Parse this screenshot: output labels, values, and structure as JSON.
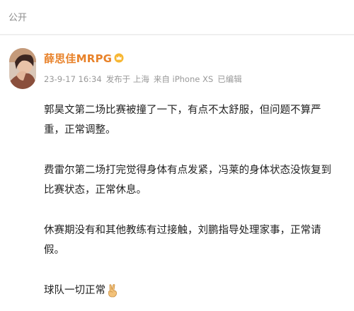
{
  "header": {
    "visibility_label": "公开"
  },
  "post": {
    "author": {
      "name": "薛思佳MRPG",
      "badge": "crown-badge-icon",
      "avatar": "avatar"
    },
    "meta": {
      "timestamp": "23-9-17 16:34",
      "location": "发布于 上海",
      "source": "来自 iPhone XS",
      "edited": "已编辑"
    },
    "paragraphs": [
      "郭昊文第二场比赛被撞了一下，有点不太舒服，但问题不算严重，正常调整。",
      "费雷尔第二场打完觉得身体有点发紧，冯莱的身体状态没恢复到比赛状态，正常休息。",
      "休赛期没有和其他教练有过接触，刘鹏指导处理家事，正常请假。",
      "球队一切正常"
    ],
    "trailing_emoji": "victory-hand-icon"
  },
  "colors": {
    "username": "#e8822a",
    "meta": "#999999",
    "body_text": "#222222",
    "header_text": "#8c8c8c"
  }
}
